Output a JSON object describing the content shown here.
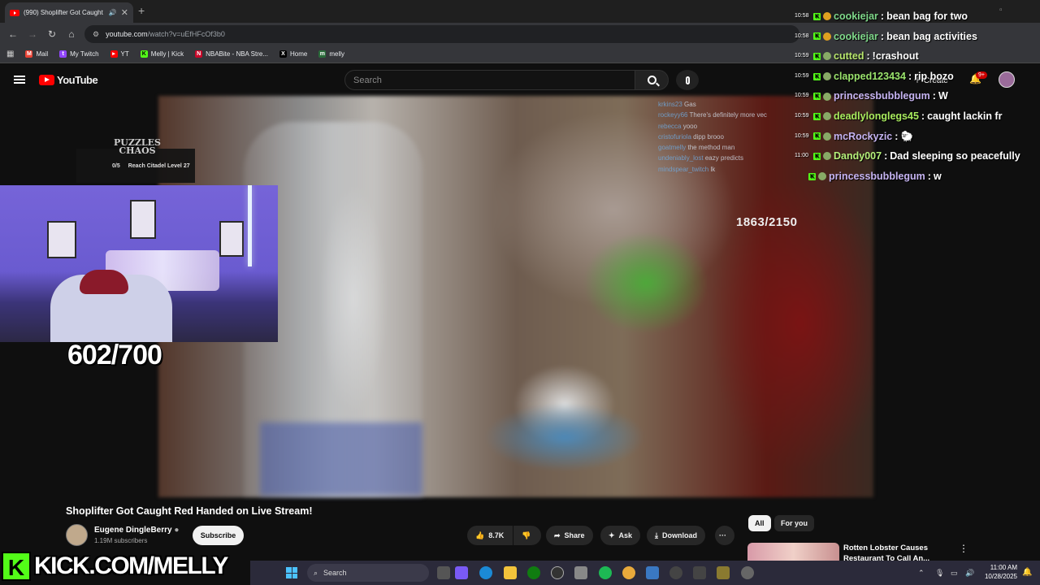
{
  "browser": {
    "tab_title": "(990) Shoplifter Got Caught",
    "url_main": "youtube.com",
    "url_rest": "/watch?v=uEfHFcOf3b0",
    "bookmarks": [
      "Mail",
      "My Twitch",
      "YT",
      "Melly | Kick",
      "NBABite - NBA Stre...",
      "Home",
      "melly"
    ]
  },
  "youtube": {
    "logo_text": "YouTube",
    "search_placeholder": "Search",
    "create_label": "Create",
    "notif_badge": "9+"
  },
  "video": {
    "title": "Shoplifter Got Caught Red Handed on Live Stream!",
    "channel": "Eugene DingleBerry",
    "subscribers": "1.19M subscribers",
    "subscribe_label": "Subscribe",
    "like_count": "8.7K",
    "share_label": "Share",
    "ask_label": "Ask",
    "download_label": "Download",
    "more_label": "···"
  },
  "overlay": {
    "goal_counter": "602/700",
    "video_counter": "1863/2150",
    "puzzle_logo_line1": "PUZZLES",
    "puzzle_logo_line2": "CHAOS",
    "puzzle_progress": "0/5",
    "puzzle_task": "Reach Citadel Level 27",
    "kick_banner": "KICK.COM/MELLY",
    "kick_logo": "K"
  },
  "ghost_chat": [
    {
      "user": "krkins23",
      "msg": "Gas"
    },
    {
      "user": "rockeyy66",
      "msg": "There's definitely more vec"
    },
    {
      "user": "rebecca",
      "msg": "yooo"
    },
    {
      "user": "cristofuriola",
      "msg": "dipp brooo"
    },
    {
      "user": "goatmelly",
      "msg": "the method man"
    },
    {
      "user": "undeniably_lost",
      "msg": "eazy predicts"
    },
    {
      "user": "mindspear_twitch",
      "msg": "lk"
    }
  ],
  "kick_chat": [
    {
      "time": "10:58",
      "user": "cookiejar",
      "msg": "bean bag for two",
      "color": "#7fd88a"
    },
    {
      "time": "10:58",
      "user": "cookiejar",
      "msg": "bean bag activities",
      "color": "#7fd88a"
    },
    {
      "time": "10:59",
      "user": "cutted",
      "msg": "!crashout",
      "color": "#b9e86e"
    },
    {
      "time": "10:59",
      "user": "clapped123434",
      "msg": "rip bozo",
      "color": "#9be46d"
    },
    {
      "time": "10:59",
      "user": "princessbubblegum",
      "msg": "W",
      "color": "#c6b4f2"
    },
    {
      "time": "10:59",
      "user": "deadlylonglegs45",
      "msg": "caught lackin fr",
      "color": "#a9ec5e"
    },
    {
      "time": "10:59",
      "user": "mcRockyzic",
      "msg": "🐑",
      "color": "#c6b4f2"
    },
    {
      "time": "11:00",
      "user": "Dandy007",
      "msg": "Dad sleeping so peacefully",
      "color": "#b6f07a"
    },
    {
      "time": "",
      "user": "princessbubblegum",
      "msg": "w",
      "color": "#c6b4f2"
    }
  ],
  "sidebar": {
    "chips": [
      "All",
      "For you"
    ],
    "rec_title": "Rotten Lobster Causes Restaurant To Call An..."
  },
  "taskbar": {
    "search_label": "Search",
    "time": "11:00 AM",
    "date": "10/28/2025"
  }
}
